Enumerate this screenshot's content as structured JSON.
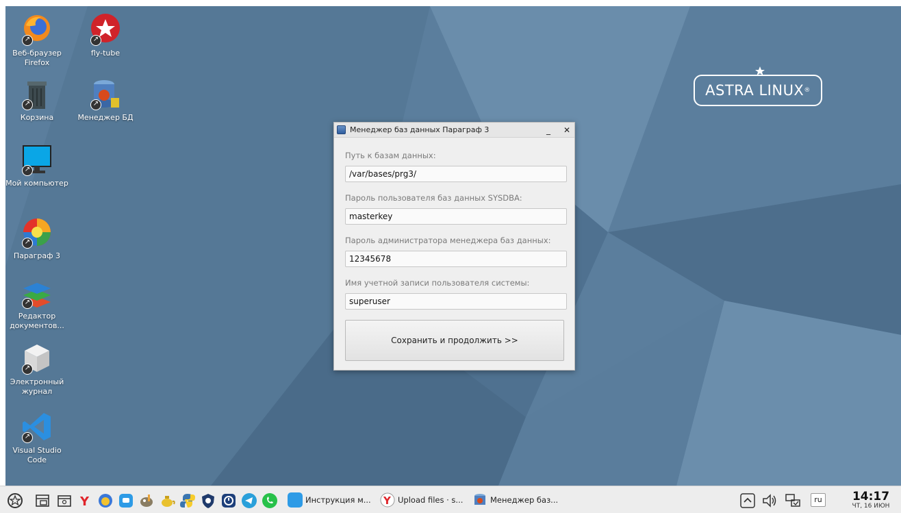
{
  "desktop_icons": [
    {
      "label": "Веб-браузер Firefox"
    },
    {
      "label": "fly-tube"
    },
    {
      "label": "Корзина"
    },
    {
      "label": "Менеджер БД"
    },
    {
      "label": "Мой компьютер"
    },
    {
      "label": "Параграф 3"
    },
    {
      "label": "Редактор документов..."
    },
    {
      "label": "Электронный журнал"
    },
    {
      "label": "Visual Studio Code"
    }
  ],
  "logo": {
    "text": "ASTRA LINUX",
    "mark": "®"
  },
  "dialog": {
    "title": "Менеджер баз данных Параграф 3",
    "minimize": "_",
    "close": "✕",
    "fields": [
      {
        "label": "Путь к базам данных:",
        "value": "/var/bases/prg3/"
      },
      {
        "label": "Пароль пользователя баз данных SYSDBA:",
        "value": "masterkey"
      },
      {
        "label": "Пароль администратора менеджера баз данных:",
        "value": "12345678"
      },
      {
        "label": "Имя учетной записи пользователя системы:",
        "value": "superuser"
      }
    ],
    "save_label": "Сохранить и продолжить >>"
  },
  "taskbar": {
    "tasks": [
      {
        "label": "Инструкция м..."
      },
      {
        "label": "Upload files · s..."
      },
      {
        "label": "Менеджер баз..."
      }
    ],
    "lang": "ru",
    "time": "14:17",
    "date": "ЧТ, 16 ИЮН"
  },
  "colors": {
    "desktop": "#5b7e9d",
    "taskbar": "#ededed",
    "dialog": "#efefef"
  }
}
